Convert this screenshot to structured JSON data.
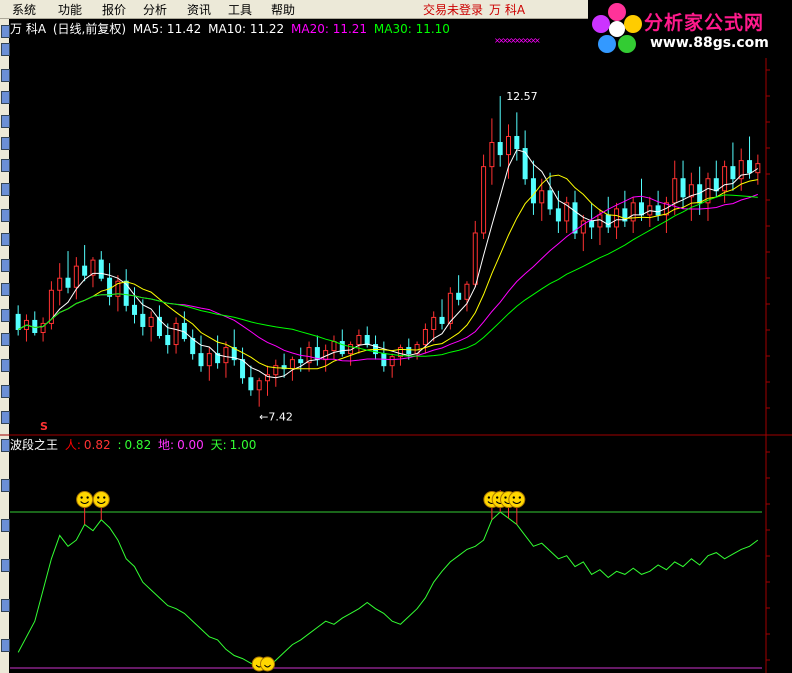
{
  "menu": {
    "items": [
      "系统",
      "功能",
      "报价",
      "分析",
      "资讯",
      "工具",
      "帮助"
    ],
    "login_status": "交易未登录",
    "current_stock": "万  科A"
  },
  "logo": {
    "title": "分析家公式网",
    "url": "www.88gs.com"
  },
  "chart_info": {
    "stock": "万  科A",
    "period": "(日线,前复权)",
    "ma5": "MA5: 11.42",
    "ma10": "MA10: 11.22",
    "ma20": "MA20: 11.21",
    "ma30": "MA30: 11.10"
  },
  "annotations": {
    "high": "12.57",
    "low": "←7.42",
    "signal": "S"
  },
  "indicator": {
    "name": "波段之王",
    "ren_label": "人:",
    "ren_value": "0.82",
    "sep": ":",
    "green_value": "0.82",
    "di_label": "地:",
    "di_value": "0.00",
    "tian_label": "天:",
    "tian_value": "1.00"
  },
  "colors": {
    "up": "#ff3232",
    "down": "#54ffff",
    "ma5": "#ffffff",
    "ma10": "#ffff00",
    "ma20": "#ff00ff",
    "ma30": "#00ff00",
    "grid": "#800000",
    "indicator_line": "#33ff33",
    "tian_line": "#33cc33",
    "di_line": "#cc33cc",
    "smiley": "#ffd700"
  },
  "chart_data": {
    "type": "candlestick",
    "price_range": [
      7.0,
      13.5
    ],
    "ohlc": [
      [
        8.95,
        9.1,
        8.6,
        8.7
      ],
      [
        8.7,
        8.95,
        8.5,
        8.85
      ],
      [
        8.85,
        9.0,
        8.6,
        8.65
      ],
      [
        8.65,
        8.9,
        8.5,
        8.8
      ],
      [
        8.8,
        9.5,
        8.7,
        9.35
      ],
      [
        9.35,
        9.8,
        9.1,
        9.55
      ],
      [
        9.55,
        10.0,
        9.3,
        9.4
      ],
      [
        9.4,
        9.9,
        9.2,
        9.75
      ],
      [
        9.75,
        10.1,
        9.5,
        9.6
      ],
      [
        9.6,
        9.9,
        9.4,
        9.85
      ],
      [
        9.85,
        10.0,
        9.5,
        9.55
      ],
      [
        9.55,
        9.8,
        9.1,
        9.25
      ],
      [
        9.25,
        9.6,
        9.0,
        9.5
      ],
      [
        9.5,
        9.7,
        9.0,
        9.1
      ],
      [
        9.1,
        9.4,
        8.8,
        8.95
      ],
      [
        8.95,
        9.2,
        8.6,
        8.75
      ],
      [
        8.75,
        9.0,
        8.5,
        8.9
      ],
      [
        8.9,
        9.1,
        8.55,
        8.6
      ],
      [
        8.6,
        8.8,
        8.3,
        8.45
      ],
      [
        8.45,
        8.9,
        8.3,
        8.8
      ],
      [
        8.8,
        9.0,
        8.5,
        8.55
      ],
      [
        8.55,
        8.7,
        8.2,
        8.3
      ],
      [
        8.3,
        8.6,
        8.0,
        8.1
      ],
      [
        8.1,
        8.4,
        7.85,
        8.3
      ],
      [
        8.3,
        8.6,
        8.05,
        8.15
      ],
      [
        8.15,
        8.5,
        7.9,
        8.4
      ],
      [
        8.4,
        8.7,
        8.1,
        8.2
      ],
      [
        8.2,
        8.4,
        7.8,
        7.9
      ],
      [
        7.9,
        8.1,
        7.6,
        7.7
      ],
      [
        7.7,
        7.9,
        7.42,
        7.85
      ],
      [
        7.85,
        8.1,
        7.6,
        7.95
      ],
      [
        7.95,
        8.2,
        7.75,
        8.1
      ],
      [
        8.1,
        8.3,
        7.9,
        8.05
      ],
      [
        8.05,
        8.25,
        7.85,
        8.2
      ],
      [
        8.2,
        8.4,
        8.0,
        8.15
      ],
      [
        8.15,
        8.5,
        8.0,
        8.4
      ],
      [
        8.4,
        8.6,
        8.1,
        8.2
      ],
      [
        8.2,
        8.45,
        8.0,
        8.35
      ],
      [
        8.35,
        8.6,
        8.2,
        8.5
      ],
      [
        8.5,
        8.7,
        8.25,
        8.3
      ],
      [
        8.3,
        8.5,
        8.1,
        8.45
      ],
      [
        8.45,
        8.7,
        8.3,
        8.6
      ],
      [
        8.6,
        8.75,
        8.4,
        8.45
      ],
      [
        8.45,
        8.6,
        8.2,
        8.3
      ],
      [
        8.3,
        8.5,
        8.0,
        8.1
      ],
      [
        8.1,
        8.3,
        7.9,
        8.25
      ],
      [
        8.25,
        8.45,
        8.1,
        8.4
      ],
      [
        8.4,
        8.55,
        8.2,
        8.3
      ],
      [
        8.3,
        8.5,
        8.2,
        8.45
      ],
      [
        8.45,
        8.8,
        8.3,
        8.7
      ],
      [
        8.7,
        9.0,
        8.5,
        8.9
      ],
      [
        8.9,
        9.2,
        8.7,
        8.8
      ],
      [
        8.8,
        9.4,
        8.7,
        9.3
      ],
      [
        9.3,
        9.6,
        9.1,
        9.2
      ],
      [
        9.2,
        9.5,
        9.0,
        9.45
      ],
      [
        9.45,
        10.5,
        9.4,
        10.3
      ],
      [
        10.3,
        11.6,
        10.2,
        11.4
      ],
      [
        11.4,
        12.2,
        11.1,
        11.8
      ],
      [
        11.8,
        12.57,
        11.4,
        11.6
      ],
      [
        11.6,
        12.1,
        11.2,
        11.9
      ],
      [
        11.9,
        12.3,
        11.5,
        11.7
      ],
      [
        11.7,
        12.0,
        11.1,
        11.2
      ],
      [
        11.2,
        11.5,
        10.6,
        10.8
      ],
      [
        10.8,
        11.2,
        10.5,
        11.0
      ],
      [
        11.0,
        11.3,
        10.6,
        10.7
      ],
      [
        10.7,
        11.0,
        10.3,
        10.5
      ],
      [
        10.5,
        10.9,
        10.3,
        10.8
      ],
      [
        10.8,
        11.0,
        10.2,
        10.3
      ],
      [
        10.3,
        10.6,
        10.0,
        10.5
      ],
      [
        10.5,
        10.8,
        10.2,
        10.4
      ],
      [
        10.4,
        10.7,
        10.1,
        10.6
      ],
      [
        10.6,
        10.9,
        10.3,
        10.4
      ],
      [
        10.4,
        10.8,
        10.2,
        10.7
      ],
      [
        10.7,
        11.0,
        10.4,
        10.5
      ],
      [
        10.5,
        10.9,
        10.3,
        10.8
      ],
      [
        10.8,
        11.2,
        10.5,
        10.6
      ],
      [
        10.6,
        10.9,
        10.4,
        10.75
      ],
      [
        10.75,
        11.0,
        10.5,
        10.6
      ],
      [
        10.6,
        10.9,
        10.3,
        10.8
      ],
      [
        10.8,
        11.5,
        10.6,
        11.2
      ],
      [
        11.2,
        11.5,
        10.7,
        10.9
      ],
      [
        10.9,
        11.3,
        10.5,
        11.1
      ],
      [
        11.1,
        11.4,
        10.6,
        10.8
      ],
      [
        10.8,
        11.3,
        10.5,
        11.2
      ],
      [
        11.2,
        11.5,
        10.9,
        11.0
      ],
      [
        11.0,
        11.5,
        10.8,
        11.4
      ],
      [
        11.4,
        11.8,
        11.0,
        11.2
      ],
      [
        11.2,
        11.7,
        11.0,
        11.5
      ],
      [
        11.5,
        11.9,
        11.2,
        11.3
      ],
      [
        11.3,
        11.6,
        11.1,
        11.45
      ]
    ],
    "indicator_values": [
      0.1,
      0.2,
      0.3,
      0.5,
      0.7,
      0.85,
      0.78,
      0.82,
      0.92,
      0.88,
      0.95,
      0.9,
      0.82,
      0.7,
      0.65,
      0.55,
      0.5,
      0.45,
      0.4,
      0.38,
      0.35,
      0.3,
      0.25,
      0.2,
      0.18,
      0.12,
      0.08,
      0.06,
      0.03,
      0.01,
      0.0,
      0.05,
      0.1,
      0.15,
      0.18,
      0.22,
      0.26,
      0.3,
      0.28,
      0.32,
      0.35,
      0.38,
      0.42,
      0.38,
      0.35,
      0.3,
      0.28,
      0.33,
      0.38,
      0.45,
      0.55,
      0.62,
      0.68,
      0.72,
      0.76,
      0.78,
      0.82,
      0.95,
      1.0,
      0.96,
      0.92,
      0.85,
      0.78,
      0.8,
      0.75,
      0.7,
      0.72,
      0.65,
      0.68,
      0.6,
      0.63,
      0.58,
      0.62,
      0.6,
      0.64,
      0.6,
      0.62,
      0.66,
      0.63,
      0.68,
      0.65,
      0.7,
      0.66,
      0.72,
      0.74,
      0.7,
      0.73,
      0.76,
      0.78,
      0.82
    ],
    "tian_level": 1.0,
    "di_level": 0.0
  }
}
